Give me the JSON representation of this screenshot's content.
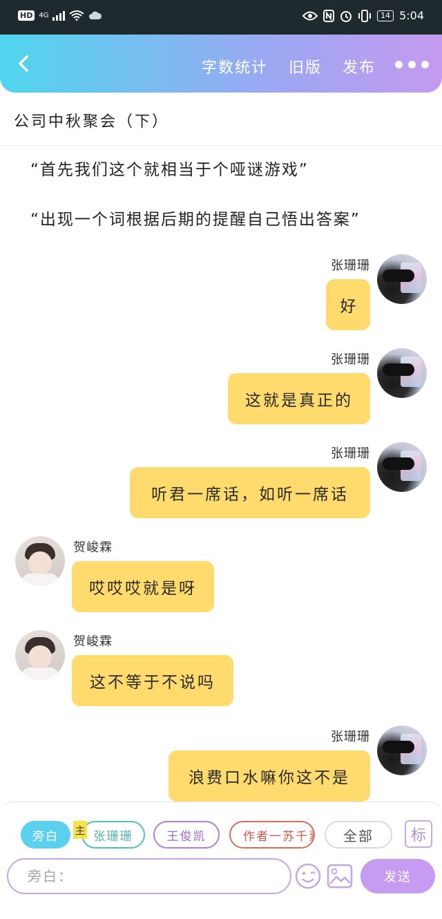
{
  "status_bar": {
    "left": {
      "hd": "HD",
      "signal": "4G"
    },
    "right": {
      "battery": "14",
      "time": "5:04"
    }
  },
  "header": {
    "back_icon": "chevron-left-icon",
    "word_count": "字数统计",
    "old_version": "旧版",
    "publish": "发布",
    "more_icon": "more-dots-icon"
  },
  "document": {
    "title": "公司中秋聚会（下）"
  },
  "narration": [
    "“首先我们这个就相当于个哑谜游戏”",
    "“出现一个词根据后期的提醒自己悟出答案”"
  ],
  "messages": [
    {
      "side": "right",
      "sender": "张珊珊",
      "text": "好"
    },
    {
      "side": "right",
      "sender": "张珊珊",
      "text": "这就是真正的"
    },
    {
      "side": "right",
      "sender": "张珊珊",
      "text": "听君一席话，如听一席话"
    },
    {
      "side": "left",
      "sender": "贺峻霖",
      "text": "哎哎哎就是呀"
    },
    {
      "side": "left",
      "sender": "贺峻霖",
      "text": "这不等于不说吗"
    },
    {
      "side": "right",
      "sender": "张珊珊",
      "text": "浪费口水嘛你这不是"
    }
  ],
  "roles": {
    "narrator": "旁白",
    "main_badge": "主",
    "zhang": "张珊珊",
    "wang": "王俊凯",
    "author": "作者一苏千素",
    "all": "全部",
    "mark": "标"
  },
  "input": {
    "placeholder": "旁白：",
    "send": "发送"
  },
  "colors": {
    "bubble": "#fedb6c",
    "header_start": "#4fd6ee",
    "header_end": "#c59af0",
    "send": "#c69cf2"
  }
}
